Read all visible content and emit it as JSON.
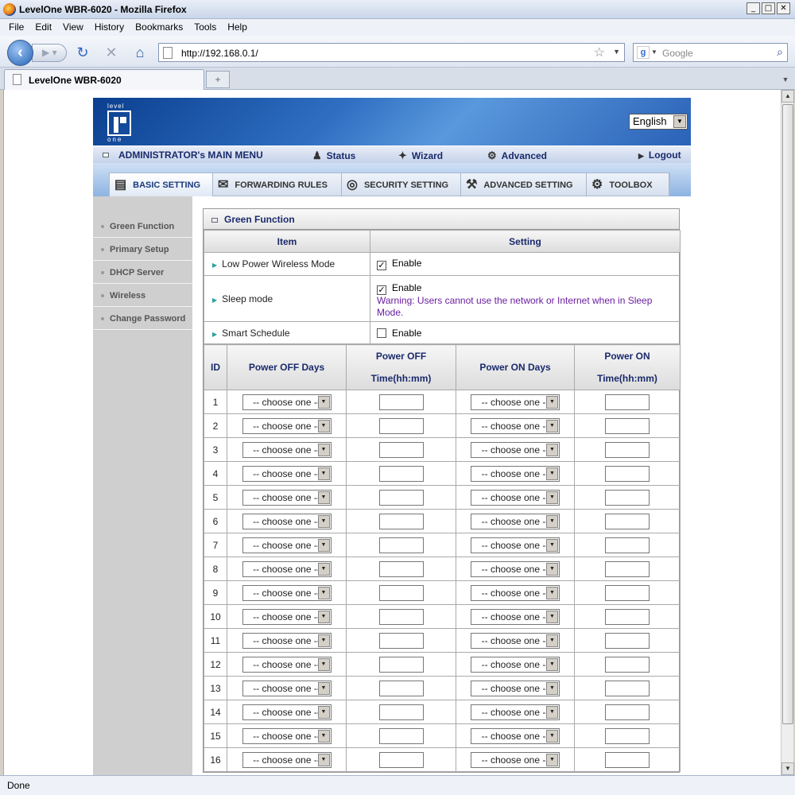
{
  "window": {
    "title": "LevelOne WBR-6020 - Mozilla Firefox",
    "controls": [
      "_",
      "□",
      "✕"
    ]
  },
  "menu": [
    "File",
    "Edit",
    "View",
    "History",
    "Bookmarks",
    "Tools",
    "Help"
  ],
  "nav": {
    "url": "http://192.168.0.1/",
    "search_placeholder": "Google"
  },
  "tab": {
    "title": "LevelOne WBR-6020",
    "new_tab": "+"
  },
  "status": "Done",
  "router": {
    "language": "English",
    "main_menu": {
      "title": "ADMINISTRATOR's MAIN MENU",
      "status": "Status",
      "wizard": "Wizard",
      "advanced": "Advanced",
      "logout": "Logout"
    },
    "sub_menu": [
      "BASIC SETTING",
      "FORWARDING RULES",
      "SECURITY SETTING",
      "ADVANCED SETTING",
      "TOOLBOX"
    ],
    "left_nav": [
      "Green Function",
      "Primary Setup",
      "DHCP Server",
      "Wireless",
      "Change Password"
    ],
    "panel_title": "Green Function",
    "headers": {
      "item": "Item",
      "setting": "Setting"
    },
    "settings": [
      {
        "label": "Low Power Wireless Mode",
        "checked": true,
        "value": "Enable"
      },
      {
        "label": "Sleep mode",
        "checked": true,
        "value": "Enable",
        "warning": "Warning: Users cannot use the network or Internet when in Sleep Mode."
      },
      {
        "label": "Smart Schedule",
        "checked": false,
        "value": "Enable"
      }
    ],
    "schedule_headers": {
      "id": "ID",
      "off_days": "Power OFF Days",
      "off_time_1": "Power OFF",
      "off_time_2": "Time(hh:mm)",
      "on_days": "Power ON Days",
      "on_time_1": "Power ON",
      "on_time_2": "Time(hh:mm)"
    },
    "choose_one": "-- choose one --",
    "rows": [
      "1",
      "2",
      "3",
      "4",
      "5",
      "6",
      "7",
      "8",
      "9",
      "10",
      "11",
      "12",
      "13",
      "14",
      "15",
      "16"
    ]
  }
}
